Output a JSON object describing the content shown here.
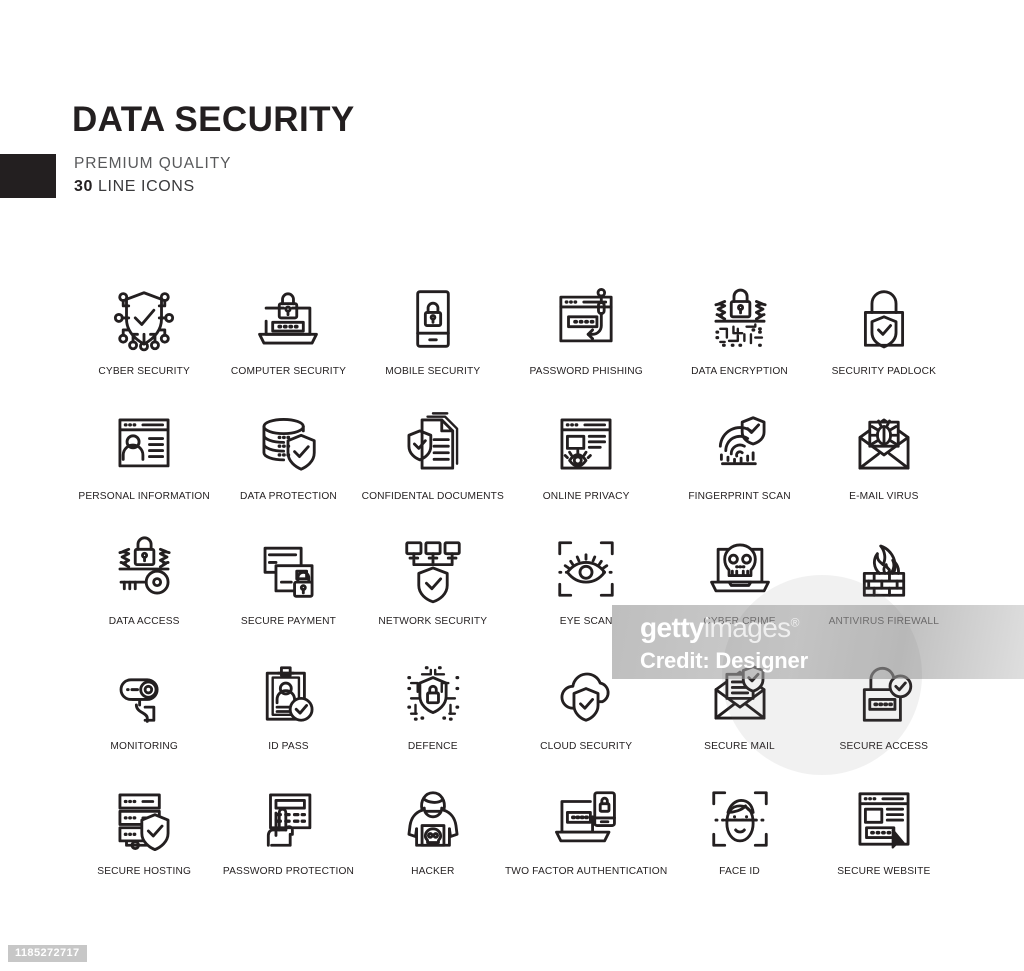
{
  "header": {
    "title": "DATA SECURITY",
    "subtitle": "PREMIUM QUALITY",
    "count": "30",
    "count_suffix": " LINE ICONS",
    "accent_color": "#231f20"
  },
  "watermark": {
    "brand_bold": "getty",
    "brand_light": "images",
    "registered": "®",
    "credit": "Credit: Designer",
    "asset_id": "1185272717"
  },
  "icons": [
    {
      "icon": "cyber-security-icon",
      "label": "CYBER SECURITY"
    },
    {
      "icon": "computer-security-icon",
      "label": "COMPUTER SECURITY"
    },
    {
      "icon": "mobile-security-icon",
      "label": "MOBILE SECURITY"
    },
    {
      "icon": "password-phishing-icon",
      "label": "PASSWORD PHISHING"
    },
    {
      "icon": "data-encryption-icon",
      "label": "DATA ENCRYPTION"
    },
    {
      "icon": "security-padlock-icon",
      "label": "SECURITY PADLOCK"
    },
    {
      "icon": "personal-information-icon",
      "label": "PERSONAL INFORMATION"
    },
    {
      "icon": "data-protection-icon",
      "label": "DATA PROTECTION"
    },
    {
      "icon": "confidental-documents-icon",
      "label": "CONFIDENTAL DOCUMENTS"
    },
    {
      "icon": "online-privacy-icon",
      "label": "ONLINE PRIVACY"
    },
    {
      "icon": "fingerprint-scan-icon",
      "label": "FINGERPRINT SCAN"
    },
    {
      "icon": "email-virus-icon",
      "label": "E-MAIL VIRUS"
    },
    {
      "icon": "data-access-icon",
      "label": "DATA ACCESS"
    },
    {
      "icon": "secure-payment-icon",
      "label": "SECURE PAYMENT"
    },
    {
      "icon": "network-security-icon",
      "label": "NETWORK  SECURITY"
    },
    {
      "icon": "eye-scan-icon",
      "label": "EYE SCAN"
    },
    {
      "icon": "cyber-crime-icon",
      "label": "CYBER CRIME"
    },
    {
      "icon": "antivirus-firewall-icon",
      "label": "ANTIVIRUS FIREWALL"
    },
    {
      "icon": "monitoring-icon",
      "label": "MONITORING"
    },
    {
      "icon": "id-pass-icon",
      "label": "ID PASS"
    },
    {
      "icon": "defence-icon",
      "label": "DEFENCE"
    },
    {
      "icon": "cloud-security-icon",
      "label": "CLOUD SECURITY"
    },
    {
      "icon": "secure-mail-icon",
      "label": "SECURE MAIL"
    },
    {
      "icon": "secure-access-icon",
      "label": "SECURE ACCESS"
    },
    {
      "icon": "secure-hosting-icon",
      "label": "SECURE HOSTING"
    },
    {
      "icon": "password-protection-icon",
      "label": "PASSWORD PROTECTION"
    },
    {
      "icon": "hacker-icon",
      "label": "HACKER"
    },
    {
      "icon": "two-factor-authentication-icon",
      "label": "TWO FACTOR AUTHENTICATION"
    },
    {
      "icon": "face-id-icon",
      "label": "FACE ID"
    },
    {
      "icon": "secure-website-icon",
      "label": "SECURE WEBSITE"
    }
  ]
}
